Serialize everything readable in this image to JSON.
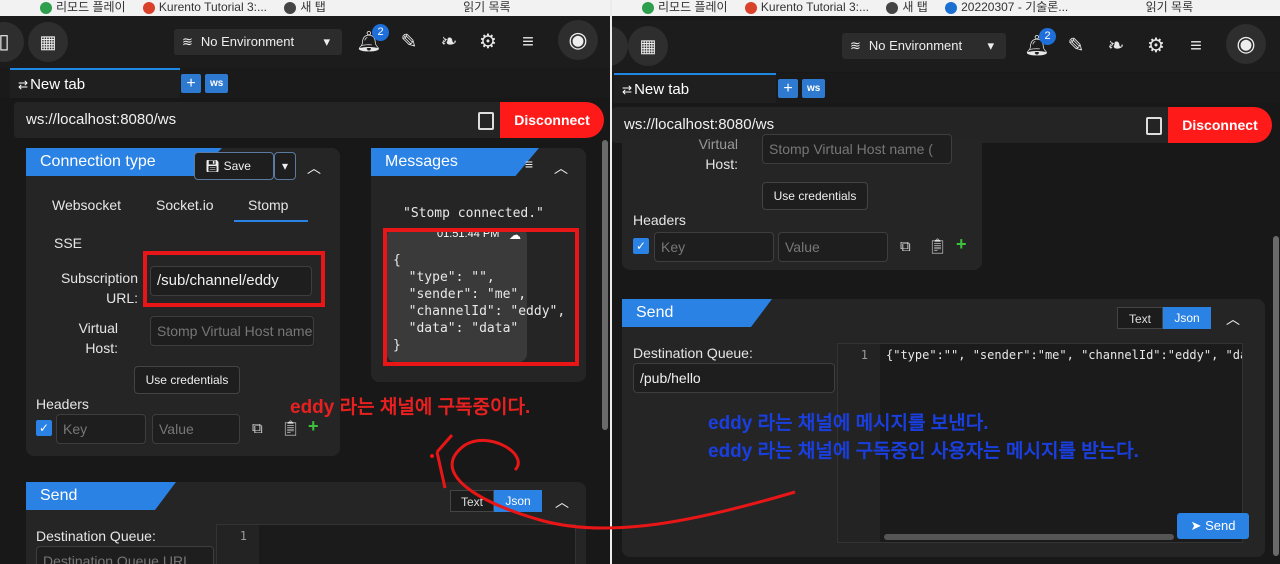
{
  "bookmarks_left": {
    "items": [
      "리모드 플레이",
      "Kurento Tutorial 3:...",
      "새 탭"
    ],
    "reading": "읽기 목록"
  },
  "bookmarks_right": {
    "items": [
      "리모드 플레이",
      "Kurento Tutorial 3:...",
      "새 탭",
      "20220307 - 기술론..."
    ],
    "reading": "읽기 목록"
  },
  "toolbar": {
    "environment": "No Environment",
    "notifications_count": "2"
  },
  "tab": {
    "label": "New tab",
    "protocol_badge": "ws"
  },
  "url_bar": {
    "url": "ws://localhost:8080/ws",
    "disconnect_label": "Disconnect"
  },
  "connection": {
    "title": "Connection type",
    "save_label": "Save",
    "types": [
      "Websocket",
      "Socket.io",
      "Stomp",
      "SSE"
    ],
    "active_type": "Stomp",
    "subscription_label_1": "Subscription",
    "subscription_label_2": "URL:",
    "subscription_value": "/sub/channel/eddy",
    "virtual_label_1": "Virtual",
    "virtual_label_2": "Host:",
    "virtual_placeholder": "Stomp Virtual Host name (",
    "credentials_label": "Use credentials",
    "headers_label": "Headers",
    "key_placeholder": "Key",
    "value_placeholder": "Value"
  },
  "messages": {
    "title": "Messages",
    "items": [
      {
        "text": "\"Stomp connected.\""
      },
      {
        "time": "01:51:44 PM",
        "body": "{\n  \"type\": \"\",\n  \"sender\": \"me\",\n  \"channelId\": \"eddy\",\n  \"data\": \"data\"\n}"
      }
    ]
  },
  "send": {
    "title": "Send",
    "text_label": "Text",
    "json_label": "Json",
    "destination_label": "Destination Queue:",
    "destination_placeholder": "Destination Queue URL",
    "destination_value": "/pub/hello",
    "line_number": "1",
    "editor_line": "{\"type\":\"\", \"sender\":\"me\", \"channelId\":\"eddy\", \"data\":\"data\"}",
    "send_label": "Send"
  },
  "annotations": {
    "subscribe_note": "eddy 라는 채널에 구독중이다.",
    "send_note_1": "eddy 라는 채널에 메시지를 보낸다.",
    "send_note_2": "eddy 라는 채널에 구독중인 사용자는 메시지를 받는다.",
    "subscribe_color": "#e82020",
    "send_color": "#1a3fe0"
  },
  "colors": {
    "accent": "#2a82e4",
    "danger": "#ff1a1a",
    "background": "#181818",
    "panel": "#252526"
  }
}
